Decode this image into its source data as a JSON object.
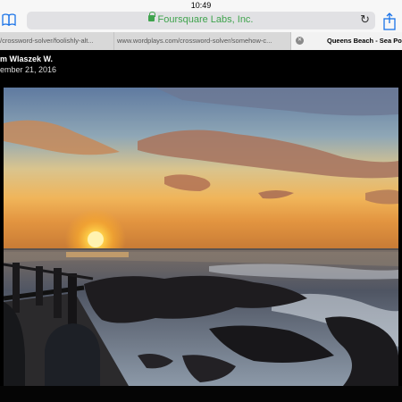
{
  "status_bar": {
    "time": "10:49"
  },
  "address_bar": {
    "site_name": "Foursquare Labs, Inc."
  },
  "tabs": [
    {
      "label": "/crossword-solver/foolishly-alt..."
    },
    {
      "label": "www.wordplays.com/crossword-solver/somehow-c..."
    },
    {
      "label": "Queens Beach - Sea Poin"
    }
  ],
  "photo_page": {
    "author": "m Wlaszek W.",
    "date": "ember 21, 2016"
  },
  "photo": {
    "description_icon": "sunset-ocean-photo"
  }
}
